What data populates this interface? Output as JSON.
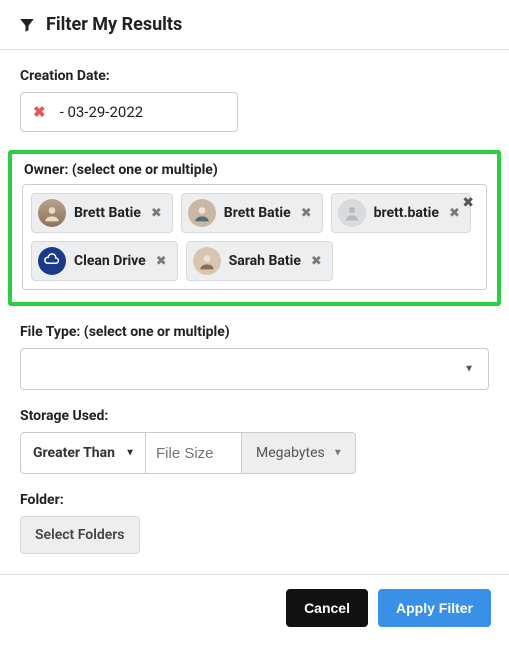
{
  "header": {
    "title": "Filter My Results"
  },
  "creationDate": {
    "label": "Creation Date:",
    "value": "- 03-29-2022"
  },
  "owner": {
    "label": "Owner: (select one or multiple)",
    "chips": [
      {
        "name": "Brett Batie",
        "avatar": "photo1"
      },
      {
        "name": "Brett Batie",
        "avatar": "photo2"
      },
      {
        "name": "brett.batie",
        "avatar": "placeholder"
      },
      {
        "name": "Clean Drive",
        "avatar": "logo"
      },
      {
        "name": "Sarah Batie",
        "avatar": "photo3"
      }
    ]
  },
  "fileType": {
    "label": "File Type: (select one or multiple)"
  },
  "storage": {
    "label": "Storage Used:",
    "comparator": "Greater Than",
    "inputPlaceholder": "File Size",
    "unit": "Megabytes"
  },
  "folder": {
    "label": "Folder:",
    "button": "Select Folders"
  },
  "footer": {
    "cancel": "Cancel",
    "apply": "Apply Filter"
  }
}
